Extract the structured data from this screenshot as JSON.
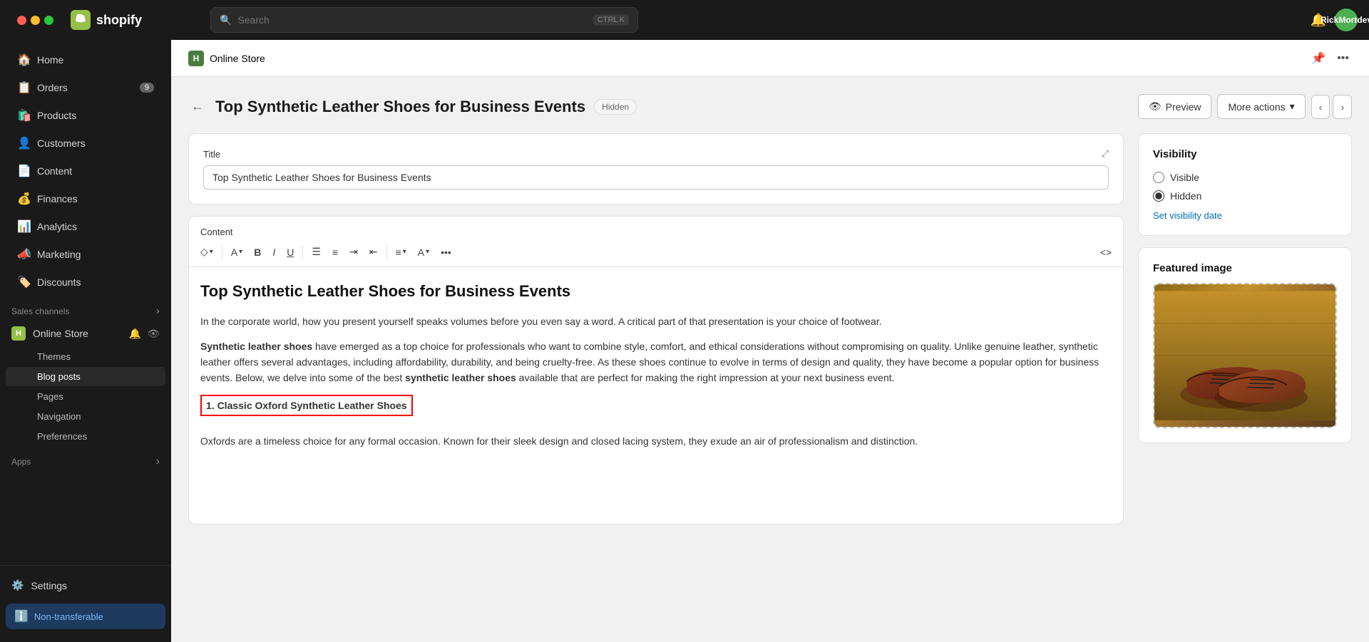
{
  "window": {
    "controls": [
      "close",
      "minimize",
      "maximize"
    ]
  },
  "topbar": {
    "logo_text": "shopify",
    "search_placeholder": "Search",
    "search_shortcut_1": "CTRL",
    "search_shortcut_2": "K",
    "username": "RickMortdev"
  },
  "sidebar": {
    "items": [
      {
        "id": "home",
        "label": "Home",
        "icon": "🏠",
        "badge": null
      },
      {
        "id": "orders",
        "label": "Orders",
        "icon": "📋",
        "badge": "9"
      },
      {
        "id": "products",
        "label": "Products",
        "icon": "🛍️",
        "badge": null
      },
      {
        "id": "customers",
        "label": "Customers",
        "icon": "👤",
        "badge": null
      },
      {
        "id": "content",
        "label": "Content",
        "icon": "📄",
        "badge": null
      },
      {
        "id": "finances",
        "label": "Finances",
        "icon": "💰",
        "badge": null
      },
      {
        "id": "analytics",
        "label": "Analytics",
        "icon": "📊",
        "badge": null
      },
      {
        "id": "marketing",
        "label": "Marketing",
        "icon": "📣",
        "badge": null
      },
      {
        "id": "discounts",
        "label": "Discounts",
        "icon": "🏷️",
        "badge": null
      }
    ],
    "sales_channels_label": "Sales channels",
    "sales_channels_expand": "›",
    "online_store": {
      "label": "Online Store",
      "sub_items": [
        {
          "id": "themes",
          "label": "Themes"
        },
        {
          "id": "blog-posts",
          "label": "Blog posts",
          "active": true
        },
        {
          "id": "pages",
          "label": "Pages"
        },
        {
          "id": "navigation",
          "label": "Navigation"
        },
        {
          "id": "preferences",
          "label": "Preferences"
        }
      ]
    },
    "apps_label": "Apps",
    "apps_expand": "›",
    "settings_label": "Settings",
    "nontransferable_label": "Non-transferable"
  },
  "breadcrumb": {
    "icon": "H",
    "text": "Online Store"
  },
  "page_header": {
    "back_label": "←",
    "title": "Top Synthetic Leather Shoes for Business Events",
    "status_badge": "Hidden",
    "preview_label": "Preview",
    "preview_icon": "👁",
    "more_actions_label": "More actions",
    "more_actions_chevron": "▾"
  },
  "title_field": {
    "label": "Title",
    "value": "Top Synthetic Leather Shoes for Business Events"
  },
  "content_field": {
    "label": "Content",
    "editor_heading": "Top Synthetic Leather Shoes for Business Events",
    "paragraph1": "In the corporate world, how you present yourself speaks volumes before you even say a word. A critical part of that presentation is your choice of footwear.",
    "paragraph2_before": "",
    "bold_text": "Synthetic leather shoes",
    "paragraph2_after": " have emerged as a top choice for professionals who want to combine style, comfort, and ethical considerations without compromising on quality. Unlike genuine leather, synthetic leather offers several advantages, including affordability, durability, and being cruelty-free. As these shoes continue to evolve in terms of design and quality, they have become a popular option for business events. Below, we delve into some of the best ",
    "bold_text2": "synthetic leather shoes",
    "paragraph2_end": " available that are perfect for making the right impression at your next business event.",
    "subheading": "1. Classic Oxford Synthetic Leather Shoes",
    "paragraph3": "Oxfords are a timeless choice for any formal occasion. Known for their sleek design and closed lacing system, they exude an air of professionalism and distinction."
  },
  "toolbar": {
    "format_icon": "◇",
    "font_icon": "A",
    "bold_icon": "B",
    "italic_icon": "I",
    "underline_icon": "U",
    "unordered_list_icon": "≡",
    "ordered_list_icon": "≡",
    "indent_icon": "⇥",
    "outdent_icon": "⇤",
    "align_icon": "≡",
    "font_color_icon": "A",
    "more_icon": "•••",
    "code_icon": "<>"
  },
  "visibility_card": {
    "title": "Visibility",
    "visible_label": "Visible",
    "hidden_label": "Hidden",
    "set_date_label": "Set visibility date"
  },
  "featured_image_card": {
    "title": "Featured image"
  }
}
